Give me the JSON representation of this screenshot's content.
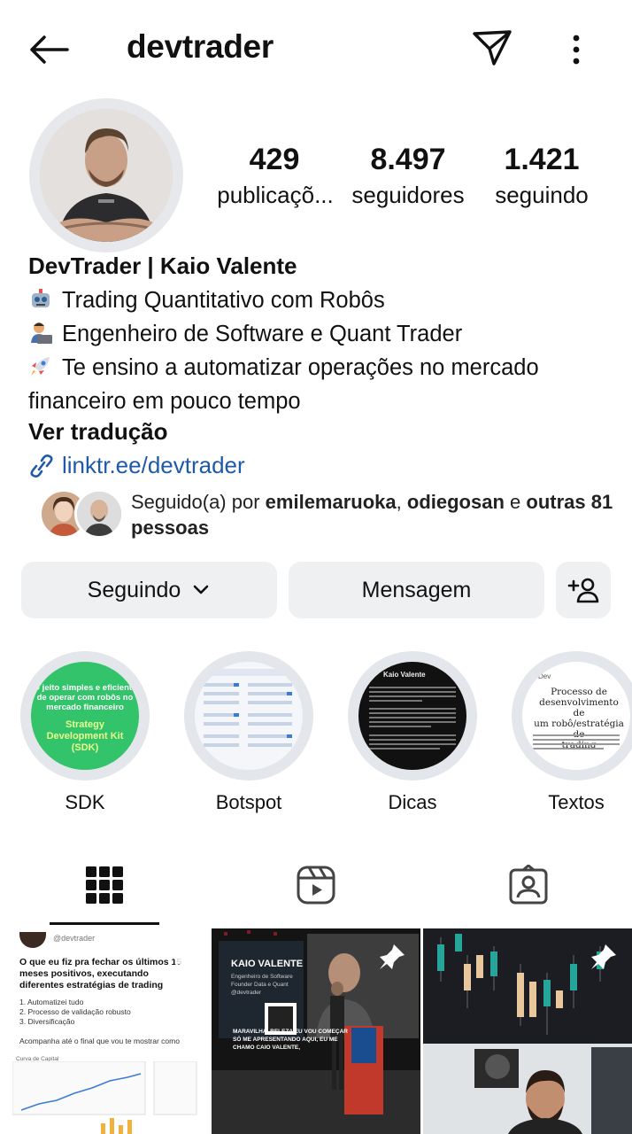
{
  "header": {
    "username": "devtrader",
    "back_icon": "arrow-left-icon",
    "share_icon": "send-icon",
    "more_icon": "more-vertical-icon"
  },
  "stats": {
    "posts": {
      "value": "429",
      "label": "publicaçõ..."
    },
    "followers": {
      "value": "8.497",
      "label": "seguidores"
    },
    "following": {
      "value": "1.421",
      "label": "seguindo"
    }
  },
  "profile": {
    "display_name": "DevTrader | Kaio Valente",
    "bio": [
      "Trading Quantitativo com Robôs",
      "Engenheiro de Software e Quant Trader",
      "Te ensino a automatizar operações no mercado",
      "financeiro em pouco tempo"
    ],
    "bio_icons": [
      "robot-emoji",
      "technologist-emoji",
      "rocket-emoji"
    ],
    "see_translation": "Ver tradução",
    "link": "linktr.ee/devtrader",
    "link_color": "#1e5aa8"
  },
  "followed_by": {
    "prefix": "Seguido(a) por",
    "user1": "emilemaruoka",
    "sep": ",",
    "user2": "odiegosan",
    "and": "e",
    "others": "outras 81 pessoas"
  },
  "actions": {
    "following": "Seguindo",
    "message": "Mensagem",
    "add_icon": "add-person-icon"
  },
  "highlights": [
    {
      "label": "SDK",
      "cover_text": [
        "O jeito simples e eficiente",
        "de operar com robôs no",
        "mercado financeiro",
        "Strategy",
        "Development Kit",
        "(SDK)"
      ]
    },
    {
      "label": "Botspot"
    },
    {
      "label": "Dicas",
      "cover_text": [
        "Kaio Valente"
      ]
    },
    {
      "label": "Textos",
      "cover_text": [
        "Dev",
        "Processo de",
        "desenvolvimento de",
        "um robô/estratégia de",
        "trading"
      ]
    }
  ],
  "tabs": [
    {
      "name": "grid",
      "icon": "grid-icon"
    },
    {
      "name": "reels",
      "icon": "reels-icon"
    },
    {
      "name": "tagged",
      "icon": "tagged-icon"
    }
  ],
  "posts": [
    {
      "handle": "@devtrader",
      "title": "O que eu fiz pra fechar os últimos 15 meses positivos, executando diferentes estratégias de trading",
      "items": [
        "1. Automatizei tudo",
        "2. Processo de validação robusto",
        "3. Diversificação"
      ],
      "footer": "Acompanha até o final que vou te mostrar como",
      "chart_label": "Curva de Capital"
    },
    {
      "slide_title": "KAIO VALENTE",
      "slide_sub": [
        "Engenheiro de Software",
        "Founder Data e Quant",
        "@devtrader"
      ],
      "caption": "MARAVILHA, BELEZA EU VOU COMEÇAR SÓ ME APRESENTANDO AQUI, EU ME CHAMO CAIO VALENTE,"
    },
    {
      "pinned": true
    }
  ]
}
